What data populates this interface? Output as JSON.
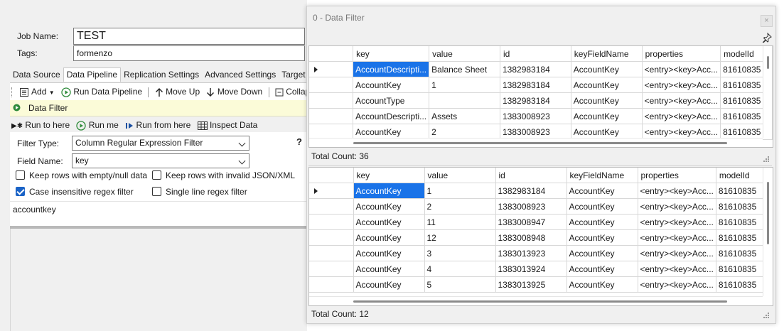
{
  "job": {
    "name_label": "Job Name:",
    "name_value": "TEST",
    "tags_label": "Tags:",
    "tags_value": "formenzo"
  },
  "tabs": [
    "Data Source",
    "Data Pipeline",
    "Replication Settings",
    "Advanced Settings",
    "Target Syste"
  ],
  "toolbar": {
    "add": "Add",
    "run_pipeline": "Run Data Pipeline",
    "move_up": "Move Up",
    "move_down": "Move Down",
    "collapse": "Collap"
  },
  "pipeline_step": "Data Filter",
  "runbar": {
    "run_to_here": "Run to here",
    "run_me": "Run me",
    "run_from_here": "Run from here",
    "inspect_data": "Inspect Data"
  },
  "filter": {
    "type_label": "Filter Type:",
    "type_value": "Column Regular Expression Filter",
    "field_label": "Field Name:",
    "field_value": "key",
    "help": "?",
    "keep_empty": "Keep rows with empty/null data",
    "keep_empty_checked": false,
    "keep_invalid": "Keep rows with invalid JSON/XML",
    "keep_invalid_checked": false,
    "case_insensitive": "Case insensitive regex filter",
    "case_insensitive_checked": true,
    "single_line": "Single line regex filter",
    "single_line_checked": false,
    "expression": "accountkey"
  },
  "dialog": {
    "title": "0 - Data Filter",
    "close": "×"
  },
  "columns": [
    "key",
    "value",
    "id",
    "keyFieldName",
    "properties",
    "modelId"
  ],
  "input_grid": {
    "rows": [
      [
        "AccountDescripti...",
        "Balance Sheet",
        "1382983184",
        "AccountKey",
        "<entry><key>Acc...",
        "81610835"
      ],
      [
        "AccountKey",
        "1",
        "1382983184",
        "AccountKey",
        "<entry><key>Acc...",
        "81610835"
      ],
      [
        "AccountType",
        "",
        "1382983184",
        "AccountKey",
        "<entry><key>Acc...",
        "81610835"
      ],
      [
        "AccountDescripti...",
        "Assets",
        "1383008923",
        "AccountKey",
        "<entry><key>Acc...",
        "81610835"
      ],
      [
        "AccountKey",
        "2",
        "1383008923",
        "AccountKey",
        "<entry><key>Acc...",
        "81610835"
      ]
    ],
    "total": "Total Count: 36"
  },
  "output_grid": {
    "rows": [
      [
        "AccountKey",
        "1",
        "1382983184",
        "AccountKey",
        "<entry><key>Acc...",
        "81610835"
      ],
      [
        "AccountKey",
        "2",
        "1383008923",
        "AccountKey",
        "<entry><key>Acc...",
        "81610835"
      ],
      [
        "AccountKey",
        "11",
        "1383008947",
        "AccountKey",
        "<entry><key>Acc...",
        "81610835"
      ],
      [
        "AccountKey",
        "12",
        "1383008948",
        "AccountKey",
        "<entry><key>Acc...",
        "81610835"
      ],
      [
        "AccountKey",
        "3",
        "1383013923",
        "AccountKey",
        "<entry><key>Acc...",
        "81610835"
      ],
      [
        "AccountKey",
        "4",
        "1383013924",
        "AccountKey",
        "<entry><key>Acc...",
        "81610835"
      ],
      [
        "AccountKey",
        "5",
        "1383013925",
        "AccountKey",
        "<entry><key>Acc...",
        "81610835"
      ]
    ],
    "total": "Total Count: 12"
  },
  "icons": {
    "add": "add-step-icon",
    "run": "play-circle-icon",
    "up": "arrow-up-icon",
    "down": "arrow-down-icon",
    "collapse": "collapse-icon",
    "pin": "pin-icon"
  },
  "colors": {
    "selection": "#1a73e8",
    "step_bar": "#fbfbd8",
    "run_green": "#2e8b3a"
  }
}
